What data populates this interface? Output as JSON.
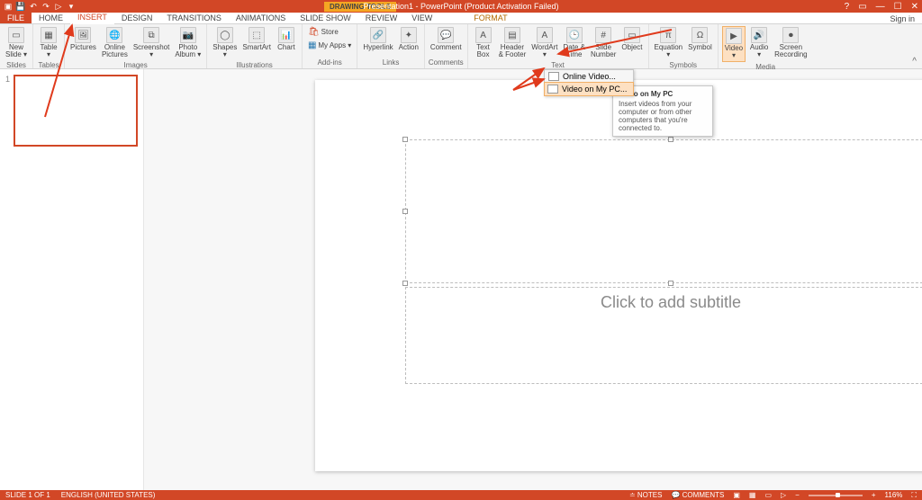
{
  "titlebar": {
    "contextual": "DRAWING TOOLS",
    "title": "Presentation1 - PowerPoint (Product Activation Failed)",
    "help_icon": "?",
    "ribbon_opts_icon": "▭",
    "min_icon": "—",
    "restore_icon": "☐",
    "close_icon": "✕"
  },
  "tabs": {
    "file": "FILE",
    "home": "HOME",
    "insert": "INSERT",
    "design": "DESIGN",
    "transitions": "TRANSITIONS",
    "animations": "ANIMATIONS",
    "slideshow": "SLIDE SHOW",
    "review": "REVIEW",
    "view": "VIEW",
    "format": "FORMAT",
    "signin": "Sign in"
  },
  "ribbon": {
    "groups": {
      "slides": "Slides",
      "tables": "Tables",
      "images": "Images",
      "illustrations": "Illustrations",
      "addins": "Add-ins",
      "links": "Links",
      "comments": "Comments",
      "text": "Text",
      "symbols": "Symbols",
      "media": "Media"
    },
    "btns": {
      "new_slide": "New\nSlide ▾",
      "table": "Table\n▾",
      "pictures": "Pictures",
      "online_pictures": "Online\nPictures",
      "screenshot": "Screenshot\n▾",
      "photo_album": "Photo\nAlbum ▾",
      "shapes": "Shapes\n▾",
      "smartart": "SmartArt",
      "chart": "Chart",
      "store": "Store",
      "my_apps": "My Apps ▾",
      "hyperlink": "Hyperlink",
      "action": "Action",
      "comment": "Comment",
      "text_box": "Text\nBox",
      "header_footer": "Header\n& Footer",
      "wordart": "WordArt\n▾",
      "date_time": "Date &\nTime",
      "slide_number": "Slide\nNumber",
      "object": "Object",
      "equation": "Equation\n▾",
      "symbol": "Symbol",
      "video": "Video\n▾",
      "audio": "Audio\n▾",
      "screen_recording": "Screen\nRecording"
    }
  },
  "dropdown": {
    "online_video": "Online Video...",
    "video_on_my_pc": "Video on My PC..."
  },
  "tooltip": {
    "title": "Video on My PC",
    "body": "Insert videos from your computer or from other computers that you're connected to."
  },
  "slide": {
    "subtitle_placeholder": "Click to add subtitle",
    "thumb_number": "1"
  },
  "statusbar": {
    "slide_info": "SLIDE 1 OF 1",
    "lang": "ENGLISH (UNITED STATES)",
    "notes": "NOTES",
    "comments": "COMMENTS",
    "zoom": "116%"
  }
}
